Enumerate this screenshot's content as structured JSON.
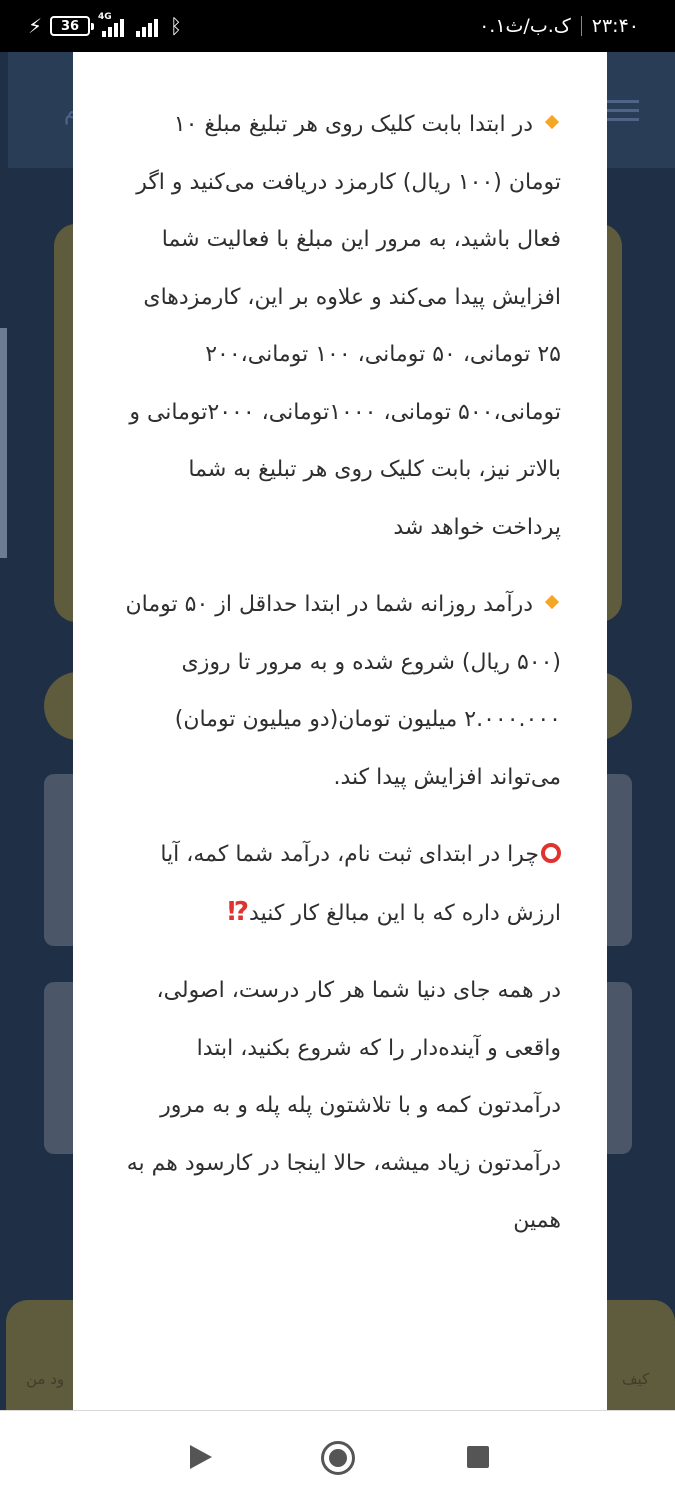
{
  "status_bar": {
    "time": "۲۳:۴۰",
    "data_speed": "۰.۱ک.ب/ث",
    "battery": "36",
    "network_tag": "4G"
  },
  "background": {
    "header_text": "م",
    "nav_left_label": "ود من",
    "nav_right_label": "کیف"
  },
  "sheet": {
    "para1": "در ابتدا بابت کلیک روی هر تبلیغ مبلغ ۱۰ تومان (۱۰۰ ریال) کارمزد دریافت می‌کنید و اگر فعال باشید، به مرور این مبلغ با فعالیت شما افزایش پیدا می‌کند و علاوه بر این، کارمزدهای ۲۵ تومانی، ۵۰ تومانی، ۱۰۰ تومانی،۲۰۰ تومانی،۵۰۰ تومانی، ۱۰۰۰تومانی، ۲۰۰۰تومانی و بالاتر نیز، بابت کلیک روی هر تبلیغ به شما پرداخت خواهد شد",
    "para2": "درآمد روزانه شما در ابتدا حداقل از ۵۰ تومان (۵۰۰ ریال) شروع شده و به مرور تا روزی ۲.۰۰۰.۰۰۰ میلیون تومان(دو میلیون تومان) می‌تواند افزایش پیدا کند.",
    "para3": "چرا در ابتدای ثبت نام، درآمد شما کمه، آیا ارزش داره که با این مبالغ کار کنید",
    "para3_emoji": "⁉",
    "para4": "در همه جای دنیا شما هر کار درست، اصولی، واقعی و آینده‌دار را که شروع بکنید، ابتدا درآمدتون کمه و با تلاشتون پله پله و به مرور درآمدتون زیاد میشه، حالا اینجا در کارسود هم به همین"
  },
  "colors": {
    "bullet": "#f5a623",
    "alert": "#e0322f",
    "text": "#2f2f2f"
  },
  "icons": [
    "bolt-icon",
    "battery-icon",
    "signal-icon",
    "bluetooth-icon",
    "diamond-bullet-icon",
    "red-circle-icon",
    "back-icon",
    "home-icon",
    "recents-icon"
  ]
}
